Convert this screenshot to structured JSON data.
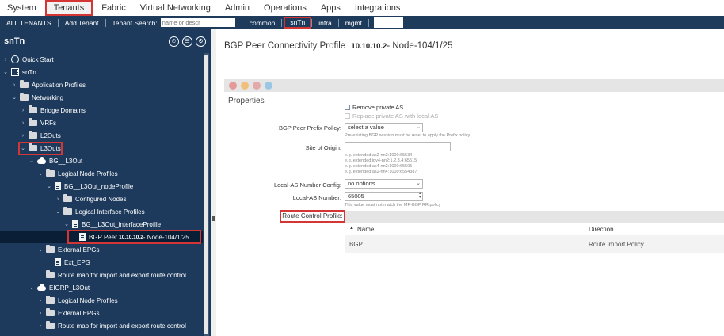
{
  "topnav": {
    "tabs": [
      "System",
      "Tenants",
      "Fabric",
      "Virtual Networking",
      "Admin",
      "Operations",
      "Apps",
      "Integrations"
    ],
    "active": "Tenants"
  },
  "subnav": {
    "all_tenants": "ALL TENANTS",
    "add_tenant": "Add Tenant",
    "search_label": "Tenant Search:",
    "search_placeholder": "name or descr",
    "tenants": [
      "common",
      "snTn",
      "infra",
      "mgmt"
    ],
    "active_tenant": "snTn"
  },
  "sidebar": {
    "title": "snTn",
    "items": [
      {
        "label": "Quick Start",
        "icon": "quick-start-icon"
      },
      {
        "label": "snTn",
        "icon": "tenant-building-icon"
      },
      {
        "label": "Application Profiles",
        "icon": "folder-icon"
      },
      {
        "label": "Networking",
        "icon": "folder-icon"
      },
      {
        "label": "Bridge Domains",
        "icon": "folder-icon"
      },
      {
        "label": "VRFs",
        "icon": "folder-icon"
      },
      {
        "label": "L2Outs",
        "icon": "folder-icon"
      },
      {
        "label": "L3Outs",
        "icon": "folder-icon"
      },
      {
        "label": "BG__L3Out",
        "icon": "cloud-icon"
      },
      {
        "label": "Logical Node Profiles",
        "icon": "folder-icon"
      },
      {
        "label": "BG__L3Out_nodeProfile",
        "icon": "document-icon"
      },
      {
        "label": "Configured Nodes",
        "icon": "folder-icon"
      },
      {
        "label": "Logical Interface Profiles",
        "icon": "folder-icon"
      },
      {
        "label": "BG__L3Out_interfaceProfile",
        "icon": "document-icon"
      },
      {
        "label_prefix": "BGP Peer ",
        "label_ip": "10.10.10.2",
        "label_suffix": "- Node-104/1/25",
        "icon": "document-icon"
      },
      {
        "label": "External EPGs",
        "icon": "folder-icon"
      },
      {
        "label": "Ext_EPG",
        "icon": "document-icon"
      },
      {
        "label": "Route map for import and export route control",
        "icon": "folder-icon"
      },
      {
        "label": "EIGRP_L3Out",
        "icon": "cloud-icon"
      },
      {
        "label": "Logical Node Profiles",
        "icon": "folder-icon"
      },
      {
        "label": "External EPGs",
        "icon": "folder-icon"
      },
      {
        "label": "Route map for import and export route control",
        "icon": "folder-icon"
      }
    ]
  },
  "main": {
    "title_prefix": "BGP Peer Connectivity Profile",
    "title_ip": "10.10.10.2",
    "title_suffix": "- Node-104/1/25",
    "properties_label": "Properties",
    "remove_private_as": "Remove private AS",
    "replace_private_as": "Replace private AS with local AS",
    "prefix_policy_label": "BGP Peer Prefix Policy:",
    "prefix_policy_value": "select a value",
    "prefix_policy_hint": "Pre-existing BGP session must be reset to apply the Prefix policy",
    "site_of_origin_label": "Site of Origin:",
    "site_of_origin_value": "",
    "soo_hints": [
      "e.g. extended:as2-nn2:1000:65534",
      "e.g. extended:ipv4-nn2:1.2.3.4:65515",
      "e.g. extended:as4-nn2:1000:65505",
      "e.g. extended:as2-nn4:1000:6554387"
    ],
    "local_as_config_label": "Local-AS Number Config:",
    "local_as_config_value": "no options",
    "local_as_label": "Local-AS Number:",
    "local_as_value": "65005",
    "local_as_hint": "This value must not match the MP-BGP RR policy",
    "route_control_label": "Route Control Profile:",
    "table": {
      "col_name": "Name",
      "col_direction": "Direction",
      "rows": [
        {
          "name": "BGP",
          "direction": "Route Import Policy"
        }
      ]
    }
  }
}
